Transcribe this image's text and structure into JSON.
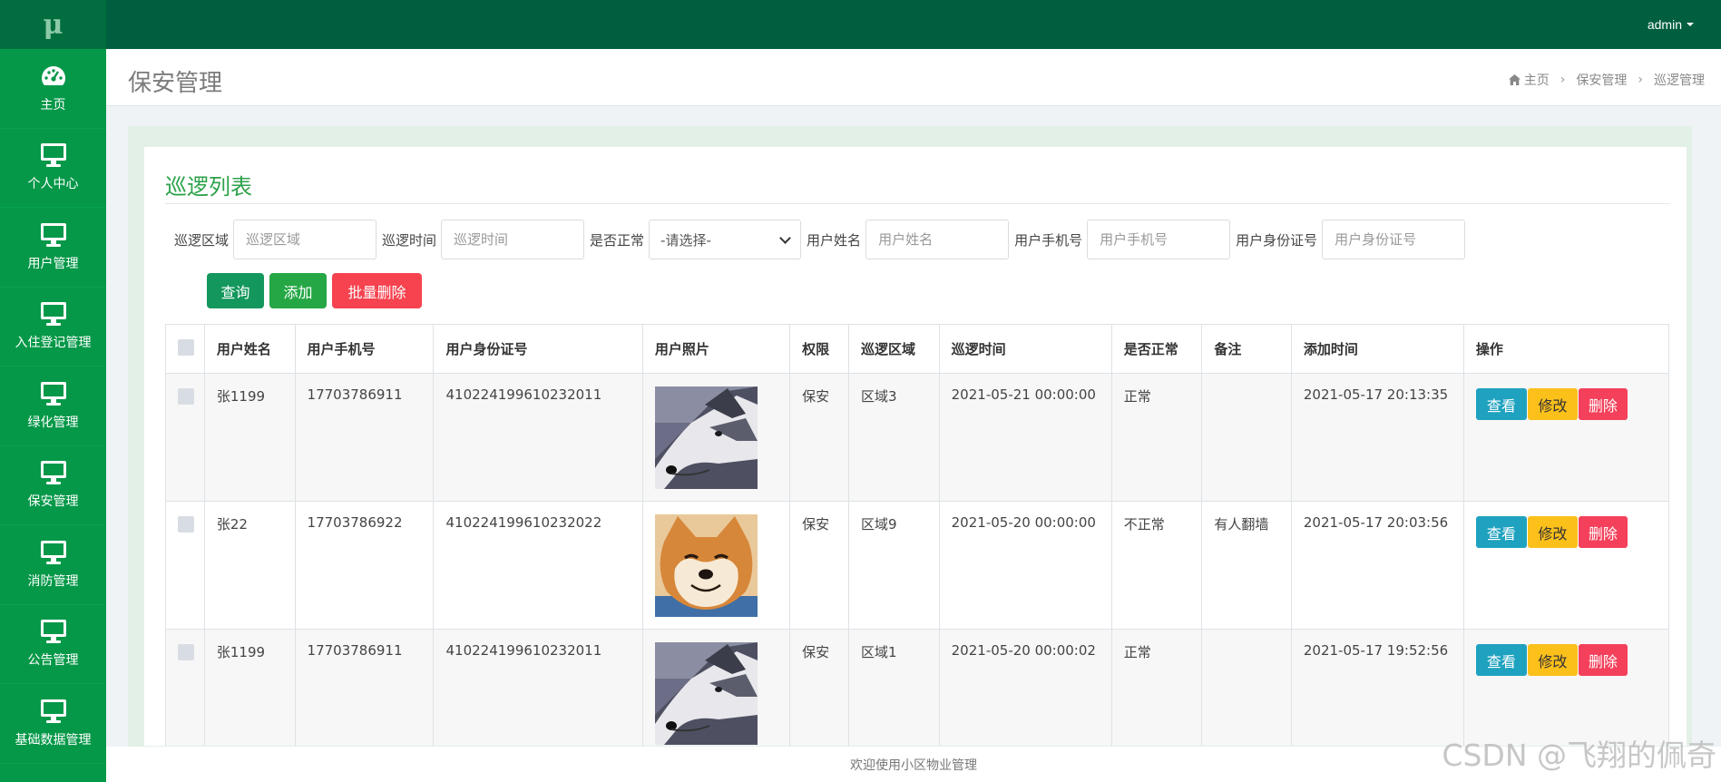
{
  "logo": "μ",
  "sidebar": {
    "items": [
      {
        "label": "主页",
        "icon": "dashboard-icon"
      },
      {
        "label": "个人中心",
        "icon": "monitor-icon"
      },
      {
        "label": "用户管理",
        "icon": "monitor-icon"
      },
      {
        "label": "入住登记管理",
        "icon": "monitor-icon"
      },
      {
        "label": "绿化管理",
        "icon": "monitor-icon"
      },
      {
        "label": "保安管理",
        "icon": "monitor-icon"
      },
      {
        "label": "消防管理",
        "icon": "monitor-icon"
      },
      {
        "label": "公告管理",
        "icon": "monitor-icon"
      },
      {
        "label": "基础数据管理",
        "icon": "monitor-icon"
      }
    ]
  },
  "topbar": {
    "user": "admin"
  },
  "header": {
    "title": "保安管理",
    "breadcrumb": [
      "主页",
      "保安管理",
      "巡逻管理"
    ]
  },
  "card": {
    "title": "巡逻列表"
  },
  "search": {
    "area_label": "巡逻区域",
    "area_placeholder": "巡逻区域",
    "time_label": "巡逻时间",
    "time_placeholder": "巡逻时间",
    "normal_label": "是否正常",
    "normal_value": "-请选择-",
    "name_label": "用户姓名",
    "name_placeholder": "用户姓名",
    "phone_label": "用户手机号",
    "phone_placeholder": "用户手机号",
    "idcard_label": "用户身份证号",
    "idcard_placeholder": "用户身份证号"
  },
  "buttons": {
    "query": "查询",
    "add": "添加",
    "batch_delete": "批量删除"
  },
  "table": {
    "headers": [
      "用户姓名",
      "用户手机号",
      "用户身份证号",
      "用户照片",
      "权限",
      "巡逻区域",
      "巡逻时间",
      "是否正常",
      "备注",
      "添加时间",
      "操作"
    ],
    "rows": [
      {
        "name": "张1199",
        "phone": "17703786911",
        "idcard": "410224199610232011",
        "photo": "husky",
        "role": "保安",
        "area": "区域3",
        "time": "2021-05-21 00:00:00",
        "normal": "正常",
        "remark": "",
        "added": "2021-05-17 20:13:35"
      },
      {
        "name": "张22",
        "phone": "17703786922",
        "idcard": "410224199610232022",
        "photo": "shiba",
        "role": "保安",
        "area": "区域9",
        "time": "2021-05-20 00:00:00",
        "normal": "不正常",
        "remark": "有人翻墙",
        "added": "2021-05-17 20:03:56"
      },
      {
        "name": "张1199",
        "phone": "17703786911",
        "idcard": "410224199610232011",
        "photo": "husky",
        "role": "保安",
        "area": "区域1",
        "time": "2021-05-20 00:00:02",
        "normal": "正常",
        "remark": "",
        "added": "2021-05-17 19:52:56"
      }
    ],
    "actions": {
      "view": "查看",
      "edit": "修改",
      "delete": "删除"
    }
  },
  "footer": "欢迎使用小区物业管理",
  "watermark": "CSDN @飞翔的佩奇",
  "colors": {
    "sidebar": "#059848",
    "topbar": "#015f3f",
    "accent": "#2da14a",
    "danger": "#f5405b",
    "warning": "#fcc01b",
    "info": "#1fa2bf"
  }
}
